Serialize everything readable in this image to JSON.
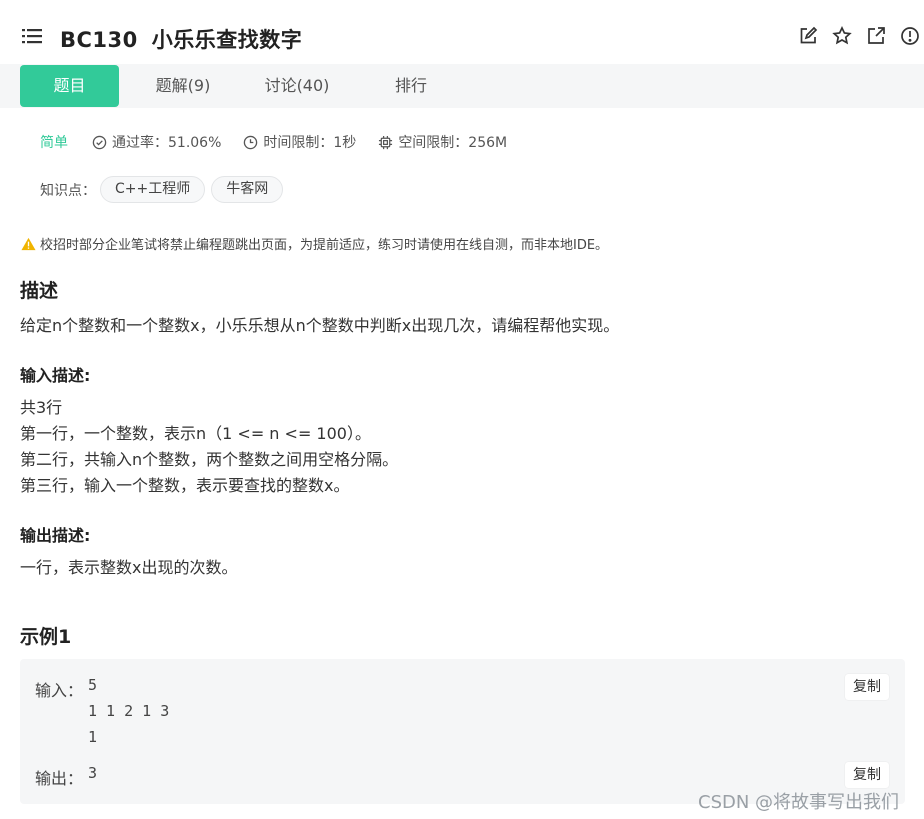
{
  "header": {
    "code": "BC130",
    "name": "小乐乐查找数字",
    "tools": [
      "edit-icon",
      "star-icon",
      "share-icon",
      "info-icon"
    ]
  },
  "tabs": [
    {
      "label": "题目",
      "active": true
    },
    {
      "label": "题解(9)",
      "active": false
    },
    {
      "label": "讨论(40)",
      "active": false
    },
    {
      "label": "排行",
      "active": false
    }
  ],
  "meta": {
    "difficulty": "简单",
    "pass_rate": "通过率：51.06%",
    "time_limit": "时间限制：1秒",
    "space_limit": "空间限制：256M"
  },
  "knowledge": {
    "label": "知识点：",
    "tags": [
      "C++工程师",
      "牛客网"
    ]
  },
  "warning": "校招时部分企业笔试将禁止编程题跳出页面，为提前适应，练习时请使用在线自测，而非本地IDE。",
  "description": {
    "heading": "描述",
    "text": "给定n个整数和一个整数x，小乐乐想从n个整数中判断x出现几次，请编程帮他实现。"
  },
  "input_desc": {
    "heading": "输入描述:",
    "lines": [
      "共3行",
      "第一行，一个整数，表示n（1 <= n <= 100）。",
      "第二行，共输入n个整数，两个整数之间用空格分隔。",
      "第三行，输入一个整数，表示要查找的整数x。"
    ]
  },
  "output_desc": {
    "heading": "输出描述:",
    "text": "一行，表示整数x出现的次数。"
  },
  "example": {
    "heading": "示例1",
    "input_label": "输入：",
    "input_lines": [
      "5",
      "1 1 2 1 3",
      "1"
    ],
    "output_label": "输出：",
    "output_value": "3",
    "copy_label": "复制"
  },
  "colors": {
    "accent": "#32ca99",
    "warning": "#f0b400"
  },
  "watermark": "CSDN @将故事写出我们"
}
